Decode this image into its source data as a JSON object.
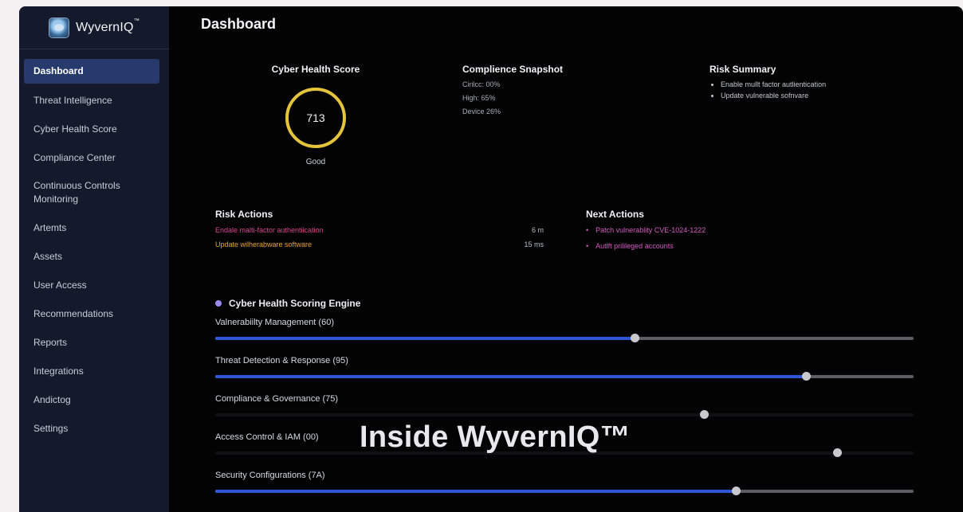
{
  "brand": {
    "name": "WyvernIQ",
    "trademark": "™"
  },
  "sidebar": {
    "items": [
      {
        "label": "Dashboard",
        "active": true
      },
      {
        "label": "Threat Intelligence"
      },
      {
        "label": "Cyber Health Score"
      },
      {
        "label": "Compliance Center"
      },
      {
        "label": "Continuous Controls Monitoring"
      },
      {
        "label": "Artemts"
      },
      {
        "label": "Assets"
      },
      {
        "label": "User Access"
      },
      {
        "label": "Recommendations"
      },
      {
        "label": "Reports"
      },
      {
        "label": "Integrations"
      },
      {
        "label": "Andictog"
      },
      {
        "label": "Settings"
      }
    ]
  },
  "header": {
    "title": "Dashboard"
  },
  "health_score": {
    "title": "Cyber Health Score",
    "value": "713",
    "rating": "Good",
    "ring_color": "#e4c43b"
  },
  "compliance": {
    "title": "Complience Snapshot",
    "lines": [
      "Cirilcc: 00%",
      "High: 65%",
      "Device 26%"
    ]
  },
  "risk_summary": {
    "title": "Risk Summary",
    "items": [
      "Enable mullt factor autlientication",
      "Update vulnerable sofnvare"
    ]
  },
  "risk_actions": {
    "title": "Risk Actions",
    "rows": [
      {
        "label": "Endale malti-factor authentiication",
        "duration": "6 m",
        "color": "#d6478f"
      },
      {
        "label": "Update wilherabware software",
        "duration": "15 ms",
        "color": "#e8a43a"
      }
    ]
  },
  "next_actions": {
    "title": "Next Actions",
    "items": [
      "Patch vulnerablity CVE-1024-1222",
      "Autlft prilileged accounts"
    ]
  },
  "engine": {
    "title": "Cyber Health Scoring Engine",
    "metrics": [
      {
        "label": "Valnerabiilty Management (60)",
        "level": 0.6,
        "filled": true
      },
      {
        "label": "Threat Detection & Response (95)",
        "level": 0.846,
        "filled": true
      },
      {
        "label": "Compliance & Governance (75)",
        "level": 0.7,
        "filled": false
      },
      {
        "label": "Access Control & IAM (00)",
        "level": 0.89,
        "filled": false
      },
      {
        "label": "Security Configurations (7A)",
        "level": 0.746,
        "filled": true
      }
    ]
  },
  "watermark": "Inside WyvernIQ™",
  "colors": {
    "accent": "#2d56d9",
    "sidebar_bg": "#141a2b",
    "active_item": "#273a6c"
  }
}
